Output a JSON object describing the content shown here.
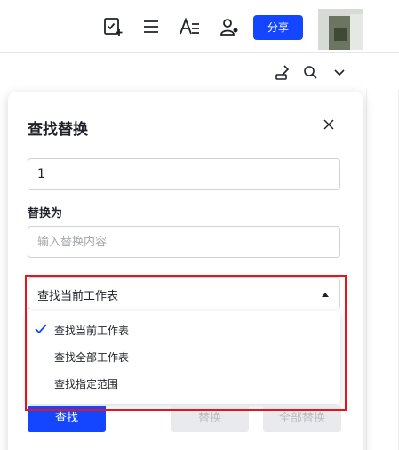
{
  "toolbar": {
    "share_label": "分享",
    "icons": [
      "task-add-icon",
      "list-icon",
      "text-format-icon",
      "collaborators-icon"
    ]
  },
  "subbar": {
    "icons": [
      "brush-icon",
      "search-icon",
      "chevron-down-icon"
    ]
  },
  "panel": {
    "title": "查找替换",
    "find_value": "1",
    "replace_label": "替换为",
    "replace_placeholder": "输入替换内容",
    "scope": {
      "selected": "查找当前工作表",
      "options": [
        "查找当前工作表",
        "查找全部工作表",
        "查找指定范围"
      ],
      "checked_index": 0
    },
    "buttons": {
      "find": "查找",
      "replace": "替换",
      "replace_all": "全部替换"
    }
  },
  "colors": {
    "accent": "#1546ff",
    "highlight": "#e8141c"
  }
}
